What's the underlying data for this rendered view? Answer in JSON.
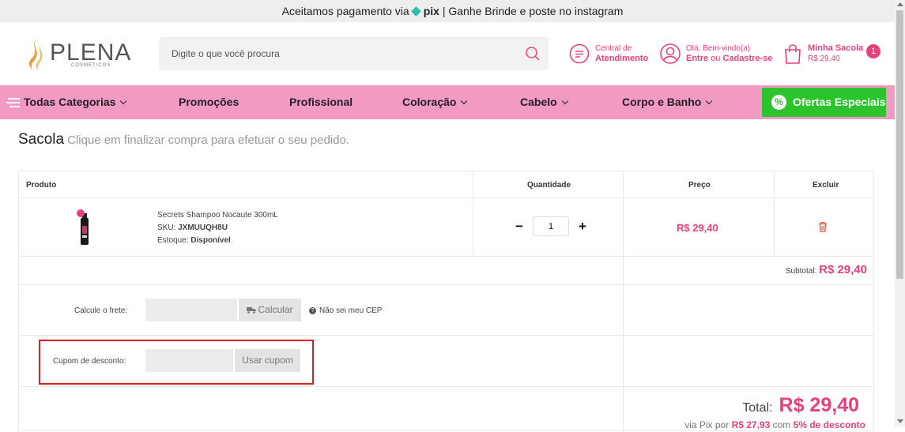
{
  "topbar": {
    "pre": "Aceitamos pagamento via",
    "pix": "pix",
    "post": "| Ganhe Brinde e poste no instagram"
  },
  "logo": {
    "name": "PLENA",
    "sub": "COSMÉTICOS"
  },
  "search": {
    "placeholder": "Digite o que você procura"
  },
  "support": {
    "line1": "Central de",
    "line2": "Atendimento"
  },
  "account": {
    "line1": "Olá, Bem-vindo(a)",
    "login": "Entre",
    "or": "ou",
    "signup": "Cadastre-se"
  },
  "bag": {
    "title": "Minha Sacola",
    "amount": "R$ 29,40",
    "count": "1"
  },
  "nav": {
    "all": "Todas Categorias",
    "promo": "Promoções",
    "pro": "Profissional",
    "color": "Coloração",
    "hair": "Cabelo",
    "body": "Corpo e Banho",
    "offers": "Ofertas Especiais"
  },
  "page": {
    "title": "Sacola",
    "subtitle": "Clique em finalizar compra para efetuar o seu pedido."
  },
  "table": {
    "col_product": "Produto",
    "col_qty": "Quantidade",
    "col_price": "Preço",
    "col_delete": "Excluir"
  },
  "item": {
    "name": "Secrets Shampoo Nocaute 300mL",
    "sku_label": "SKU:",
    "sku": "JXMUUQH8U",
    "stock_label": "Estoque:",
    "stock": "Disponível",
    "qty": "1",
    "price": "R$ 29,40"
  },
  "subtotal": {
    "label": "Subtotal:",
    "value": "R$ 29,40"
  },
  "shipping": {
    "label": "Calcule o frete:",
    "button": "Calcular",
    "help": "Não sei meu CEP"
  },
  "coupon": {
    "label": "Cupom de desconto:",
    "button": "Usar cupom"
  },
  "total": {
    "label": "Total:",
    "value": "R$ 29,40"
  },
  "pix_discount": {
    "pre": "via Pix por",
    "value": "R$ 27,93",
    "mid": "com",
    "pct": "5% de desconto"
  },
  "colors": {
    "accent": "#e6417e",
    "nav_bg": "#f39ac3",
    "offers_bg": "#2cc42c",
    "highlight_border": "#e02020"
  }
}
